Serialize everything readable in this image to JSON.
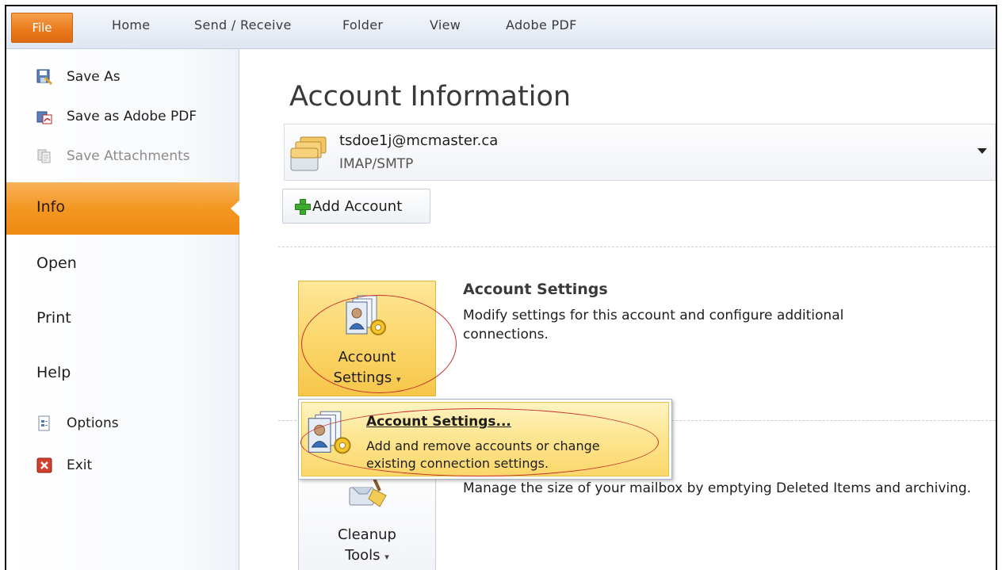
{
  "ribbon": {
    "tabs": [
      "File",
      "Home",
      "Send / Receive",
      "Folder",
      "View",
      "Adobe PDF"
    ]
  },
  "sidebar": {
    "commands": [
      {
        "label": "Save As",
        "icon": "save-as-icon",
        "disabled": false
      },
      {
        "label": "Save as Adobe PDF",
        "icon": "adobe-pdf-icon",
        "disabled": false
      },
      {
        "label": "Save Attachments",
        "icon": "attachments-icon",
        "disabled": true
      }
    ],
    "selected": "Info",
    "nav": [
      "Open",
      "Print",
      "Help"
    ],
    "bottom_commands": [
      {
        "label": "Options",
        "icon": "options-icon"
      },
      {
        "label": "Exit",
        "icon": "exit-icon"
      }
    ]
  },
  "main": {
    "title": "Account Information",
    "account": {
      "email": "tsdoe1j@mcmaster.ca",
      "type": "IMAP/SMTP"
    },
    "add_account_label": "Add Account",
    "account_settings": {
      "button_line1": "Account",
      "button_line2": "Settings",
      "title": "Account Settings",
      "description": "Modify settings for this account and configure additional connections."
    },
    "cleanup": {
      "button_line1": "Cleanup",
      "button_line2": "Tools",
      "description": "Manage the size of your mailbox by emptying Deleted Items and archiving."
    },
    "dropdown": {
      "title": "Account Settings...",
      "desc_line1": "Add and remove accounts or change",
      "desc_line2": "existing connection settings."
    }
  },
  "colors": {
    "file_tab": "#ea7b1d",
    "info_highlight": "#f39722",
    "button_hot": "#fcd870",
    "annotation": "#c8322c"
  }
}
